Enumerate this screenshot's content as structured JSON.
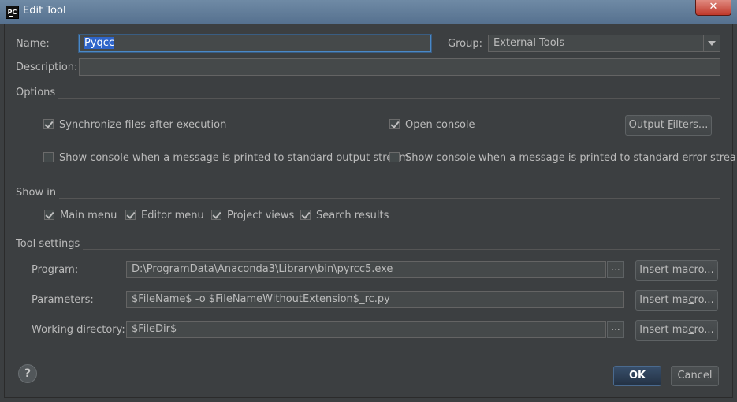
{
  "window": {
    "title": "Edit Tool"
  },
  "form": {
    "name_label": "Name:",
    "name_value": "Pyqcc",
    "group_label": "Group:",
    "group_value": "External Tools",
    "description_label": "Description:",
    "description_value": ""
  },
  "options": {
    "section_title": "Options",
    "sync_files": {
      "label": "Synchronize files after execution",
      "checked": true
    },
    "open_console": {
      "label": "Open console",
      "checked": true
    },
    "output_filters_pre": "Output ",
    "output_filters_mnemonic": "F",
    "output_filters_post": "ilters...",
    "console_stdout": {
      "label": "Show console when a message is printed to standard output stream",
      "checked": false
    },
    "console_stderr": {
      "label": "Show console when a message is printed to standard error stream",
      "checked": false
    }
  },
  "show_in": {
    "section_title": "Show in",
    "items": [
      {
        "label": "Main menu",
        "checked": true
      },
      {
        "label": "Editor menu",
        "checked": true
      },
      {
        "label": "Project views",
        "checked": true
      },
      {
        "label": "Search results",
        "checked": true
      }
    ]
  },
  "tool_settings": {
    "section_title": "Tool settings",
    "program_label": "Program:",
    "program_value": "D:\\ProgramData\\Anaconda3\\Library\\bin\\pyrcc5.exe",
    "parameters_label": "Parameters:",
    "parameters_value": "$FileName$ -o $FileNameWithoutExtension$_rc.py",
    "workdir_label": "Working directory:",
    "workdir_value": "$FileDir$",
    "browse_label": "...",
    "insert_macro_pre": "Insert ma",
    "insert_macro_mnemonic": "c",
    "insert_macro_post": "ro..."
  },
  "footer": {
    "help_label": "?",
    "ok_label": "OK",
    "cancel_label": "Cancel"
  },
  "icons": {
    "app": "pycharm-icon",
    "close": "close-icon",
    "dropdown": "chevron-down-icon",
    "help": "help-icon"
  },
  "colors": {
    "background": "#3c3f41",
    "titlebar": "#6f8aa5",
    "field": "#45494a",
    "focus": "#4a88c7",
    "selection": "#2f65ca",
    "close": "#c0392b"
  }
}
